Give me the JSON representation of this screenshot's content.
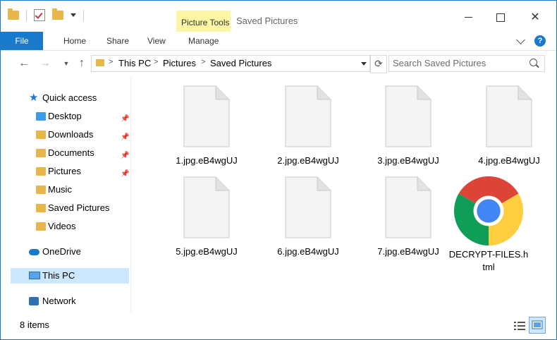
{
  "window": {
    "title": "Saved Pictures",
    "context_tab": "Picture Tools"
  },
  "ribbon": {
    "tabs": {
      "file": "File",
      "home": "Home",
      "share": "Share",
      "view": "View",
      "manage": "Manage"
    },
    "help": "?"
  },
  "address": {
    "crumbs": [
      "This PC",
      "Pictures",
      "Saved Pictures"
    ],
    "separator": ">"
  },
  "search": {
    "placeholder": "Search Saved Pictures"
  },
  "sidebar": {
    "quick_access": "Quick access",
    "items": [
      {
        "label": "Desktop",
        "icon": "folder-blue-icon",
        "pinned": true
      },
      {
        "label": "Downloads",
        "icon": "download-folder-icon",
        "pinned": true
      },
      {
        "label": "Documents",
        "icon": "documents-folder-icon",
        "pinned": true
      },
      {
        "label": "Pictures",
        "icon": "pictures-folder-icon",
        "pinned": true
      },
      {
        "label": "Music",
        "icon": "music-folder-icon",
        "pinned": false
      },
      {
        "label": "Saved Pictures",
        "icon": "folder-icon",
        "pinned": false
      },
      {
        "label": "Videos",
        "icon": "videos-folder-icon",
        "pinned": false
      }
    ],
    "onedrive": "OneDrive",
    "this_pc": "This PC",
    "network": "Network"
  },
  "files": [
    {
      "name": "1.jpg.eB4wgUJ",
      "icon": "blank-file-icon"
    },
    {
      "name": "2.jpg.eB4wgUJ",
      "icon": "blank-file-icon"
    },
    {
      "name": "3.jpg.eB4wgUJ",
      "icon": "blank-file-icon"
    },
    {
      "name": "4.jpg.eB4wgUJ",
      "icon": "blank-file-icon"
    },
    {
      "name": "5.jpg.eB4wgUJ",
      "icon": "blank-file-icon"
    },
    {
      "name": "6.jpg.eB4wgUJ",
      "icon": "blank-file-icon"
    },
    {
      "name": "7.jpg.eB4wgUJ",
      "icon": "blank-file-icon"
    },
    {
      "name": "DECRYPT-FILES.html",
      "icon": "chrome-icon"
    }
  ],
  "status": {
    "item_count": "8 items"
  },
  "colors": {
    "accent": "#1979ca",
    "context_tab": "#fbf5a4",
    "selection": "#cce8ff"
  }
}
